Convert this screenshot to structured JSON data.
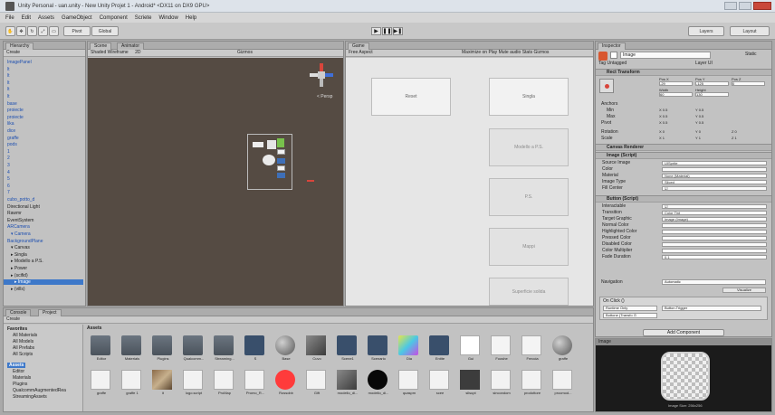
{
  "window": {
    "title": "Unity Personal - uan.unity - New Unity Projet 1 - Android* <DX11 on DX9 GPU>"
  },
  "menu": [
    "File",
    "Edit",
    "Assets",
    "GameObject",
    "Component",
    "Scriete",
    "Window",
    "Help"
  ],
  "toolbar": {
    "pivot": "Pivot",
    "global": "Global",
    "account": "Account",
    "layers": "Layers",
    "layout": "Layout"
  },
  "hierarchy": {
    "tab": "Hierarchy",
    "create": "Create",
    "items": [
      {
        "label": "ImagePanel",
        "color": "blue"
      },
      {
        "label": "lt",
        "color": "blue"
      },
      {
        "label": "lt",
        "color": "blue"
      },
      {
        "label": "lt",
        "color": "blue"
      },
      {
        "label": "lt",
        "color": "blue"
      },
      {
        "label": "lt",
        "color": "blue"
      },
      {
        "label": "base",
        "color": "blue"
      },
      {
        "label": "proiecte",
        "color": "blue"
      },
      {
        "label": "proiecte",
        "color": "blue"
      },
      {
        "label": "lika",
        "color": "blue"
      },
      {
        "label": "dice",
        "color": "blue"
      },
      {
        "label": "graffe",
        "color": "blue"
      },
      {
        "label": "pods",
        "color": "blue"
      },
      {
        "label": "1",
        "color": "blue"
      },
      {
        "label": "2",
        "color": "blue"
      },
      {
        "label": "3",
        "color": "blue"
      },
      {
        "label": "4",
        "color": "blue"
      },
      {
        "label": "5",
        "color": "blue"
      },
      {
        "label": "6",
        "color": "blue"
      },
      {
        "label": "7",
        "color": "blue"
      },
      {
        "label": "cubo_potto_d",
        "color": "blue"
      },
      {
        "label": "Directional Light",
        "color": "black"
      },
      {
        "label": "Rawmr",
        "color": "black"
      },
      {
        "label": "EventSystem",
        "color": "black"
      },
      {
        "label": "ARCamera",
        "color": "blue"
      },
      {
        "label": "▾ Camera",
        "color": "blue"
      },
      {
        "label": "BackgroundPlane",
        "color": "blue"
      },
      {
        "label": "▾ Canvas",
        "color": "black"
      },
      {
        "label": "▸ Singla",
        "color": "black"
      },
      {
        "label": "▸ Modello a P.S.",
        "color": "black"
      },
      {
        "label": "▸ Power",
        "color": "black"
      },
      {
        "label": "▸ (scifid)",
        "color": "black"
      },
      {
        "label": "▸ Image",
        "color": "black"
      },
      {
        "label": "▸ (vills)",
        "color": "black"
      }
    ],
    "selected_index": 32
  },
  "scene": {
    "tab": "Scene",
    "tab2": "Animator",
    "shading": "Shaded Wireframe",
    "mode": "2D",
    "gizmos": "Gizmos",
    "persp": "< Persp"
  },
  "game": {
    "tab": "Game",
    "aspect": "Free Aspect",
    "options": "Maximize on Play  Mute audio  Stats  Gizmos",
    "buttons": [
      {
        "label": "Reset",
        "faded": false
      },
      {
        "label": "Singla",
        "faded": false
      },
      {
        "label": "Modello a P.S.",
        "faded": true
      },
      {
        "label": "P.S.",
        "faded": true
      },
      {
        "label": "Mappi",
        "faded": true
      },
      {
        "label": "Superficie solida",
        "faded": true
      }
    ]
  },
  "inspector": {
    "tab": "Inspector",
    "name": "Image",
    "tag": "Untagged",
    "layer": "UI",
    "static": "Static",
    "rect_transform": "Rect Transform",
    "pos_labels": [
      "Pos X",
      "Pos Y",
      "Pos Z"
    ],
    "pos_values": [
      "-29",
      "-125",
      "0"
    ],
    "size_labels": [
      "Width",
      "Height"
    ],
    "size_values": [
      "60",
      "130"
    ],
    "anchors": "Anchors",
    "min": "Min",
    "max": "Max",
    "pivot": "Pivot",
    "anchor_min": [
      "X 0.5",
      "Y 0.5"
    ],
    "anchor_max": [
      "X 0.5",
      "Y 0.5"
    ],
    "pivot_vals": [
      "X 0.5",
      "Y 0.5"
    ],
    "rotation": "Rotation",
    "scale": "Scale",
    "rot_vals": [
      "X 0",
      "Y 0",
      "Z 0"
    ],
    "scale_vals": [
      "X 1",
      "Y 1",
      "Z 1"
    ],
    "canvas_renderer": "Canvas Renderer",
    "image_script": "Image (Script)",
    "image_fields": [
      {
        "label": "Source Image",
        "value": "UISprite"
      },
      {
        "label": "Color",
        "value": ""
      },
      {
        "label": "Material",
        "value": "None (Material)"
      },
      {
        "label": "Image Type",
        "value": "Sliced"
      },
      {
        "label": "Fill Center",
        "value": "☑"
      }
    ],
    "button_script": "Button (Script)",
    "button_fields": [
      {
        "label": "Interactable",
        "value": "☑"
      },
      {
        "label": "Transition",
        "value": "Color Tint"
      },
      {
        "label": "Target Graphic",
        "value": "Image (Image)"
      },
      {
        "label": "Normal Color",
        "value": ""
      },
      {
        "label": "Highlighted Color",
        "value": ""
      },
      {
        "label": "Pressed Color",
        "value": ""
      },
      {
        "label": "Disabled Color",
        "value": ""
      },
      {
        "label": "Color Multiplier",
        "value": ""
      },
      {
        "label": "Fade Duration",
        "value": "0.1"
      }
    ],
    "navigation": "Navigation",
    "navigation_value": "Automatic",
    "visualize": "Visualize",
    "on_click": "On Click ()",
    "runtime_only": "Runtime Only",
    "function_value": "Button.Trigger",
    "object_value": "Bottone (Transfo ⊙",
    "add_component": "Add Component",
    "preview_tab": "Image",
    "preview_caption": "Image Size: 256x256"
  },
  "project": {
    "tab": "Console",
    "tab2": "Project",
    "create": "Create",
    "favorites_title": "Favorites",
    "favorites": [
      "All Materials",
      "All Models",
      "All Prefabs",
      "All Scripts"
    ],
    "assets_title": "Assets",
    "folders": [
      "Editor",
      "Materials",
      "Plugins",
      "QualcommAugmentedRea",
      "StreamingAssets"
    ],
    "breadcrumb": "Assets",
    "row1": [
      "Editor",
      "Materials",
      "Plugins",
      "Qualcomm...",
      "Streaming...",
      "S",
      "Base",
      "Cuvo",
      "Scene1",
      "Scenario",
      "Dia",
      "Entite",
      "Gui",
      "Fooshe",
      "Freccia",
      "graffe"
    ],
    "row2": [
      "graffe",
      "graffe 1",
      "it",
      "logo.script",
      "ProMap",
      "Promo_R...",
      "Rossobb",
      "Gift",
      "modello_di...",
      "modello_di...",
      "quaspm",
      "scee",
      "silsupt",
      "sincondom",
      "prodottore",
      "procmod..."
    ]
  },
  "colors": {
    "accent": "#3d78c9",
    "scene_bg": "#554b43",
    "game_bg": "#e6e6e6",
    "selected": "#3d78c9",
    "red_ball": "#ff3b3b",
    "preview_bg": "#1b1b1b"
  }
}
